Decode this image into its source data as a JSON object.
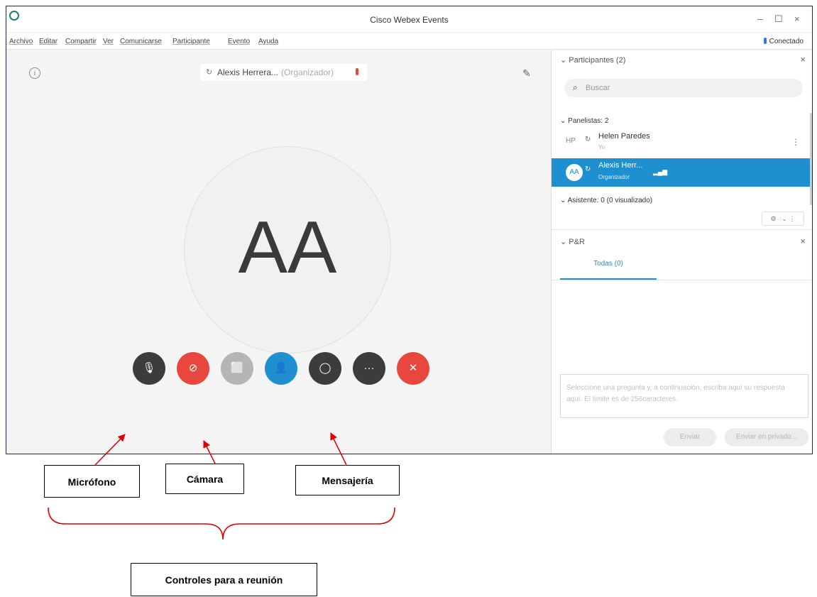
{
  "window": {
    "title": "Cisco Webex Events",
    "controls": {
      "minimize": "–",
      "maximize": "☐",
      "close": "×"
    },
    "status": "Conectado"
  },
  "menu": [
    "Archivo",
    "Editar",
    "Compartir",
    "Ver",
    "Comunicarse",
    "Participante",
    "Evento",
    "Ayuda"
  ],
  "video": {
    "speaker_name": "Alexis Herrera...",
    "speaker_role": "(Organizador)",
    "avatar_initials": "AA"
  },
  "controls": [
    {
      "name": "microphone-button",
      "color": "#3c3c3c",
      "glyph": "🎙"
    },
    {
      "name": "camera-button",
      "color": "#e8473d",
      "glyph": "⊘"
    },
    {
      "name": "share-button",
      "color": "#b5b5b5",
      "glyph": "⬜"
    },
    {
      "name": "participants-button",
      "color": "#1e90d0",
      "glyph": "👤"
    },
    {
      "name": "chat-button",
      "color": "#3c3c3c",
      "glyph": "◯"
    },
    {
      "name": "more-button",
      "color": "#3c3c3c",
      "glyph": "···"
    },
    {
      "name": "end-call-button",
      "color": "#e8473d",
      "glyph": "✕"
    }
  ],
  "participants_panel": {
    "title": "Participantes (2)",
    "search_placeholder": "Buscar",
    "panelists_header": "Panelistas: 2",
    "panelists": [
      {
        "initials": "HP",
        "name": "Helen Paredes",
        "sub": "Yo"
      },
      {
        "initials": "AA",
        "name": "Alexis Herr...",
        "sub": "Organizador"
      }
    ],
    "attendees_header": "Asistente: 0 (0 visualizado)"
  },
  "qa_panel": {
    "title": "P&R",
    "tab_all": "Todas (0)",
    "answer_placeholder": "Seleccione una pregunta y, a continuación, escriba aquí su respuesta aquí. El límite es de 256caracteres.",
    "send_label": "Enviar",
    "send_private_label": "Enviar en privado..."
  },
  "annotations": {
    "microphone": "Micrófono",
    "camera": "Cámara",
    "messaging": "Mensajería",
    "controls": "Controles para a reunión"
  },
  "colors": {
    "accent": "#1e90d0",
    "red": "#e8473d",
    "callout": "#e00000"
  }
}
